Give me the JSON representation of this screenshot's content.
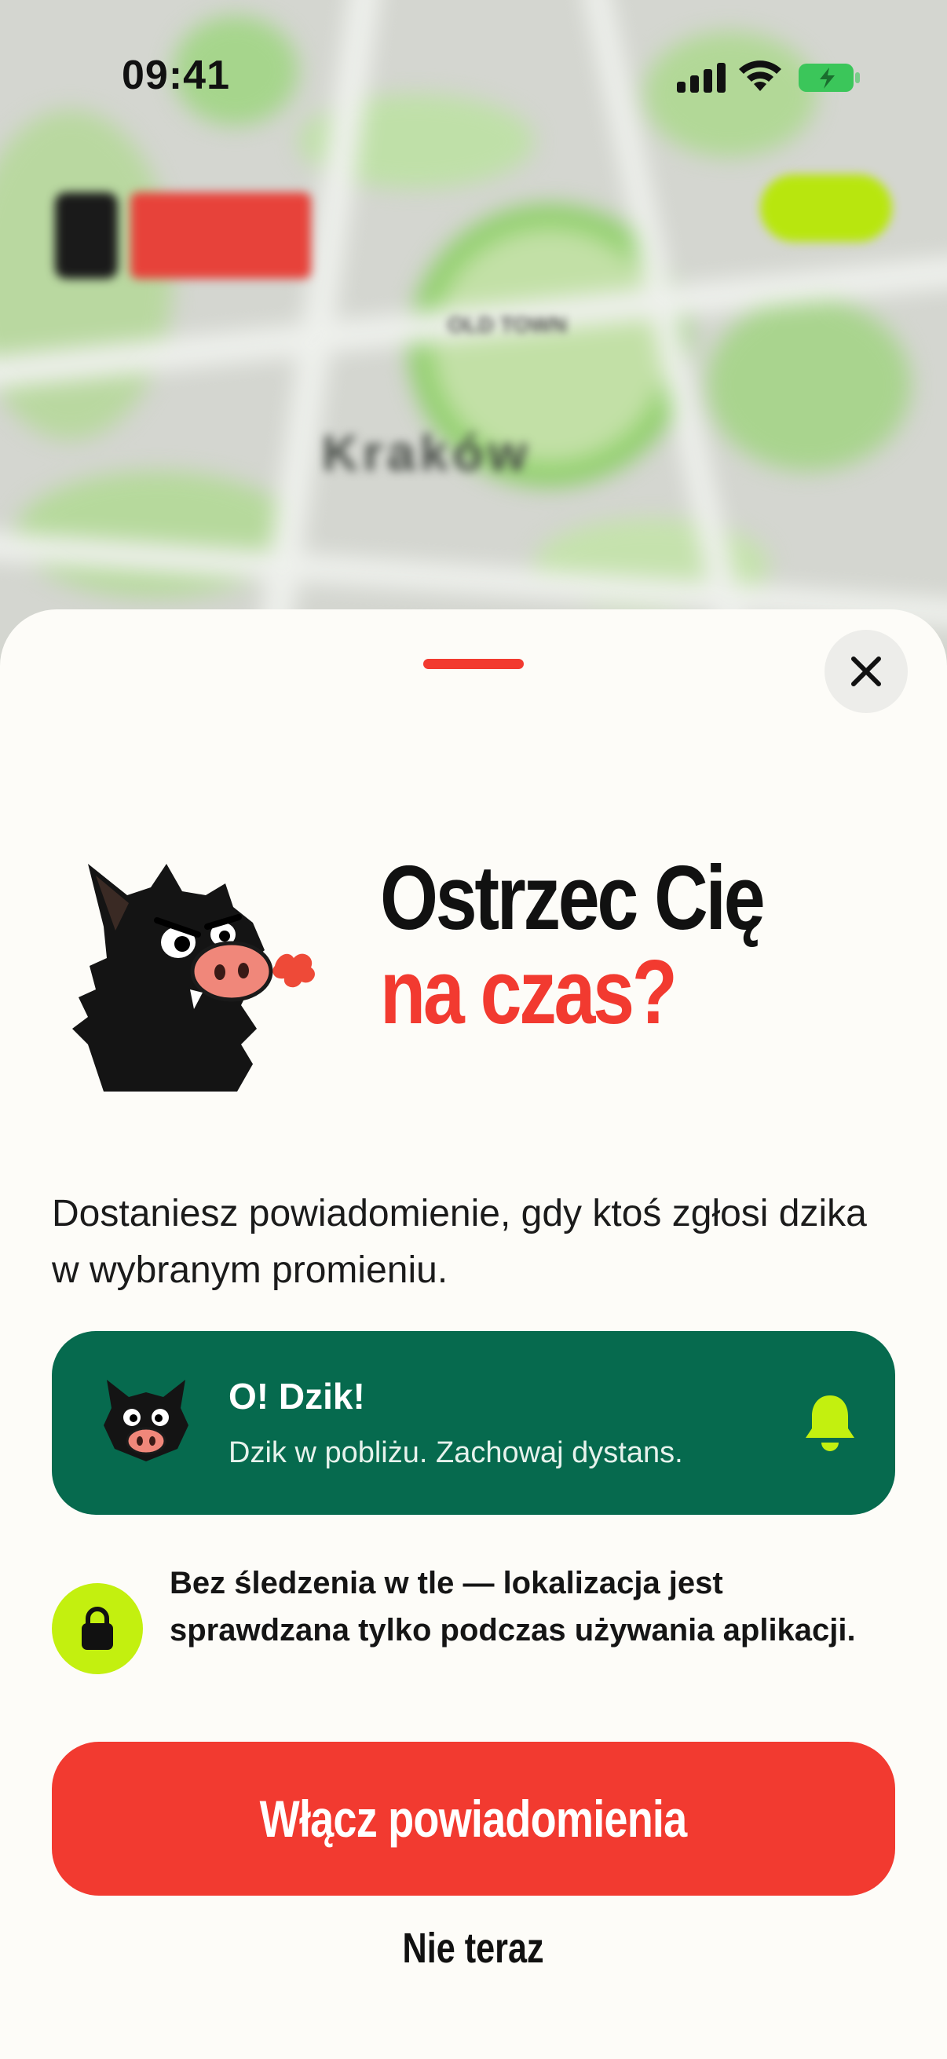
{
  "status_bar": {
    "time": "09:41"
  },
  "map_background": {
    "city_label": "Kraków",
    "district_label": "OLD TOWN"
  },
  "sheet": {
    "title_line1": "Ostrzec Cię",
    "title_line2": "na czas?",
    "description": "Dostaniesz powiadomienie, gdy ktoś zgłosi dzika w wybranym promieniu.",
    "notification_preview": {
      "app_name": "O! Dzik!",
      "message": "Dzik w pobliżu. Zachowaj dystans."
    },
    "privacy_note": "Bez śledzenia w tle — lokalizacja jest sprawdzana tylko podczas używania aplikacji.",
    "primary_button": "Włącz powiadomienia",
    "secondary_button": "Nie teraz"
  },
  "colors": {
    "accent_red": "#f23a30",
    "notif_green": "#066a4e",
    "lime": "#c3f00f",
    "sheet_bg": "#fdfcf8"
  }
}
